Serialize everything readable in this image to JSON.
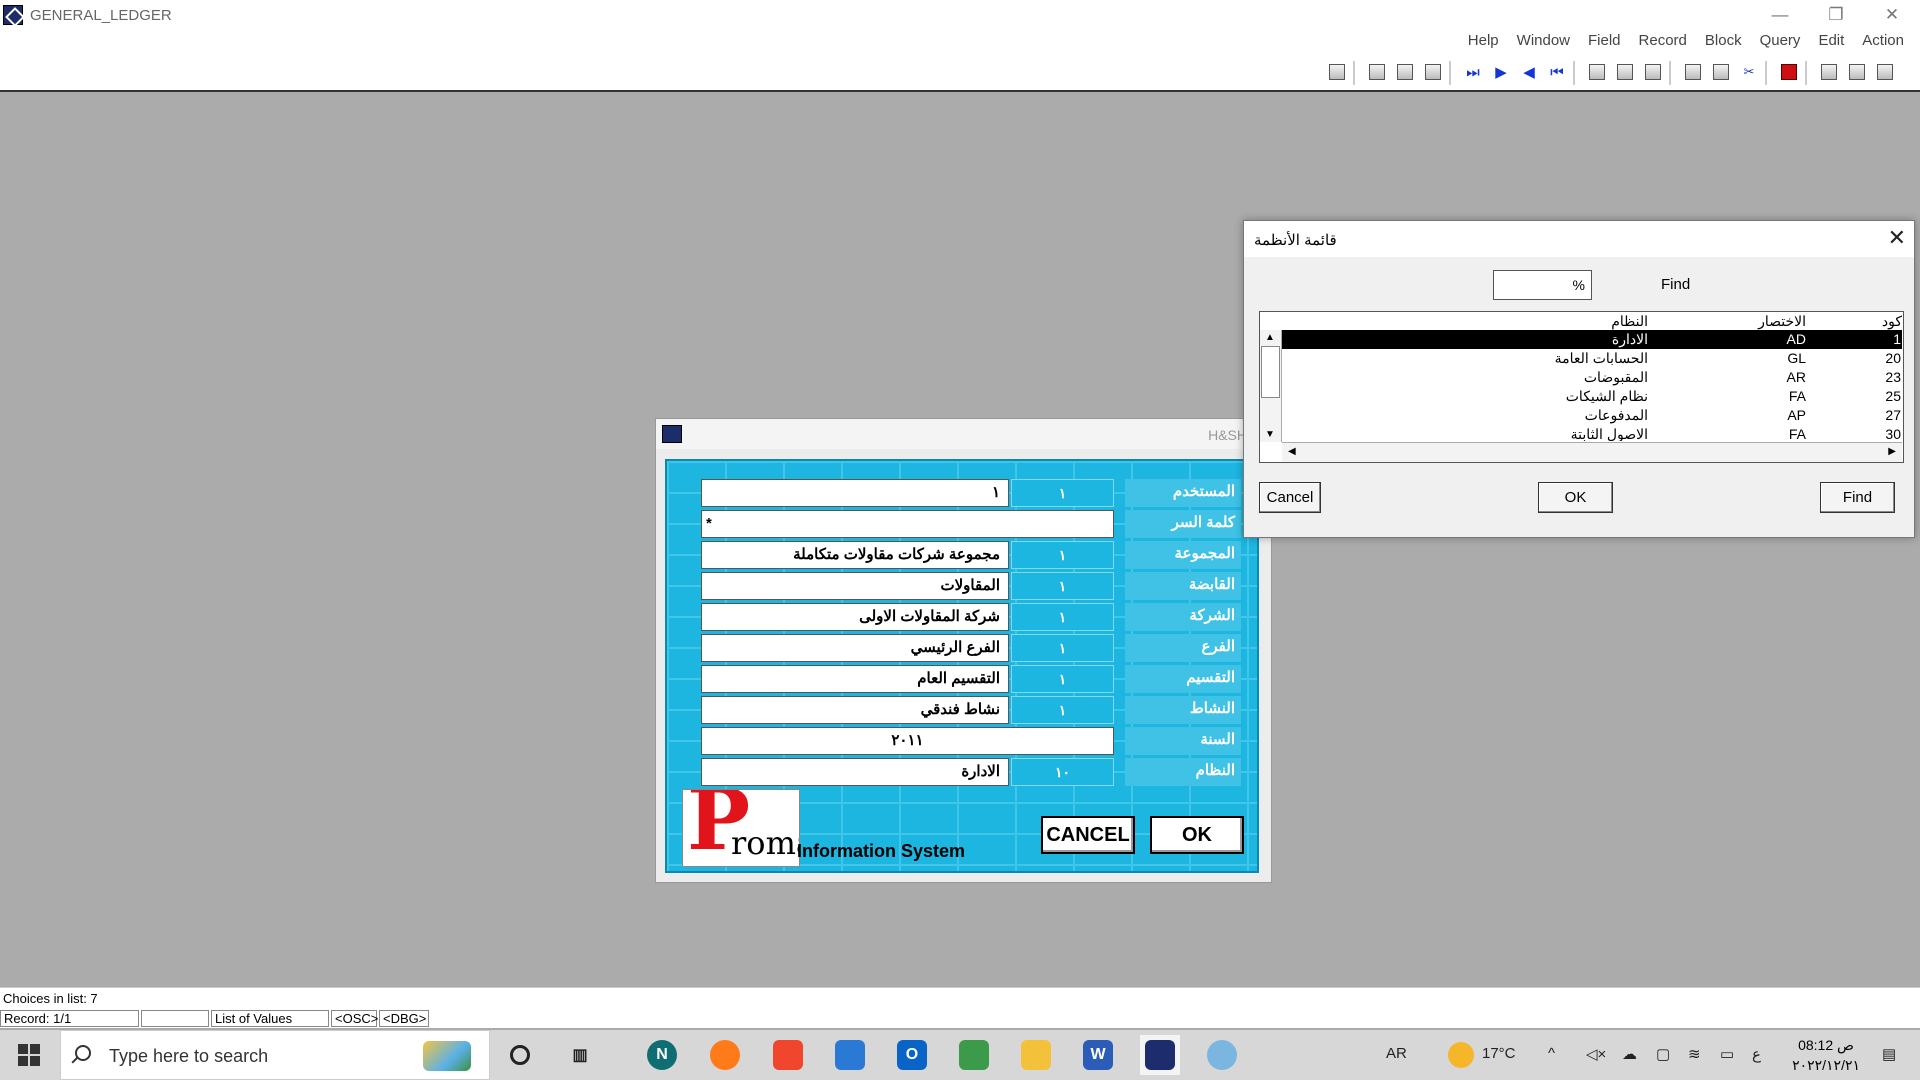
{
  "window": {
    "title": "GENERAL_LEDGER",
    "controls": [
      "—",
      "❐",
      "✕"
    ]
  },
  "menu": [
    "Action",
    "Edit",
    "Query",
    "Block",
    "Record",
    "Field",
    "Window",
    "Help"
  ],
  "login_form": {
    "header_title": "H&SH",
    "rows": [
      {
        "label": "المستخدم",
        "code": "١",
        "value": "١"
      },
      {
        "label": "كلمة السر",
        "code": "",
        "value": "*"
      },
      {
        "label": "المجموعة",
        "code": "١",
        "value": "مجموعة شركات مقاولات متكاملة"
      },
      {
        "label": "القابضة",
        "code": "١",
        "value": "المقاولات"
      },
      {
        "label": "الشركة",
        "code": "١",
        "value": "شركة المقاولات الاولى"
      },
      {
        "label": "الفرع",
        "code": "١",
        "value": "الفرع الرئيسي"
      },
      {
        "label": "التقسيم",
        "code": "١",
        "value": "التقسيم العام"
      },
      {
        "label": "النشاط",
        "code": "١",
        "value": "نشاط فندقي"
      },
      {
        "label": "السنة",
        "code": "",
        "value": "٢٠١١"
      },
      {
        "label": "النظام",
        "code": "١٠",
        "value": "الادارة"
      }
    ],
    "logo_letter": "P",
    "logo_text": "roma",
    "tagline": "Information System",
    "cancel_label": "CANCEL",
    "ok_label": "OK"
  },
  "lov_dialog": {
    "title": "قائمة الأنظمة",
    "find_value": "%",
    "find_label": "Find",
    "columns": {
      "code": "كود",
      "abbr": "الاختصار",
      "name": "النظام"
    },
    "rows": [
      {
        "code": "1",
        "abbr": "AD",
        "name": "الادارة",
        "selected": true
      },
      {
        "code": "20",
        "abbr": "GL",
        "name": "الحسابات العامة",
        "selected": false
      },
      {
        "code": "23",
        "abbr": "AR",
        "name": "المقبوضات",
        "selected": false
      },
      {
        "code": "25",
        "abbr": "FA",
        "name": "نظام الشيكات",
        "selected": false
      },
      {
        "code": "27",
        "abbr": "AP",
        "name": "المدفوعات",
        "selected": false
      },
      {
        "code": "30",
        "abbr": "FA",
        "name": "الاصول الثابتة",
        "selected": false
      }
    ],
    "cancel_label": "Cancel",
    "ok_label": "OK",
    "find_button_label": "Find"
  },
  "status": {
    "message": "Choices in list: 7",
    "record": "Record: 1/1",
    "blank": "",
    "mode": "List of Values",
    "osc": "<OSC>",
    "dbg": "<DBG>"
  },
  "taskbar": {
    "search_placeholder": "Type here to search",
    "language": "AR",
    "temperature": "17°C",
    "time": "08:12 ص",
    "date": "٢٠٢٢/١٢/٢١",
    "ime": "ع"
  }
}
